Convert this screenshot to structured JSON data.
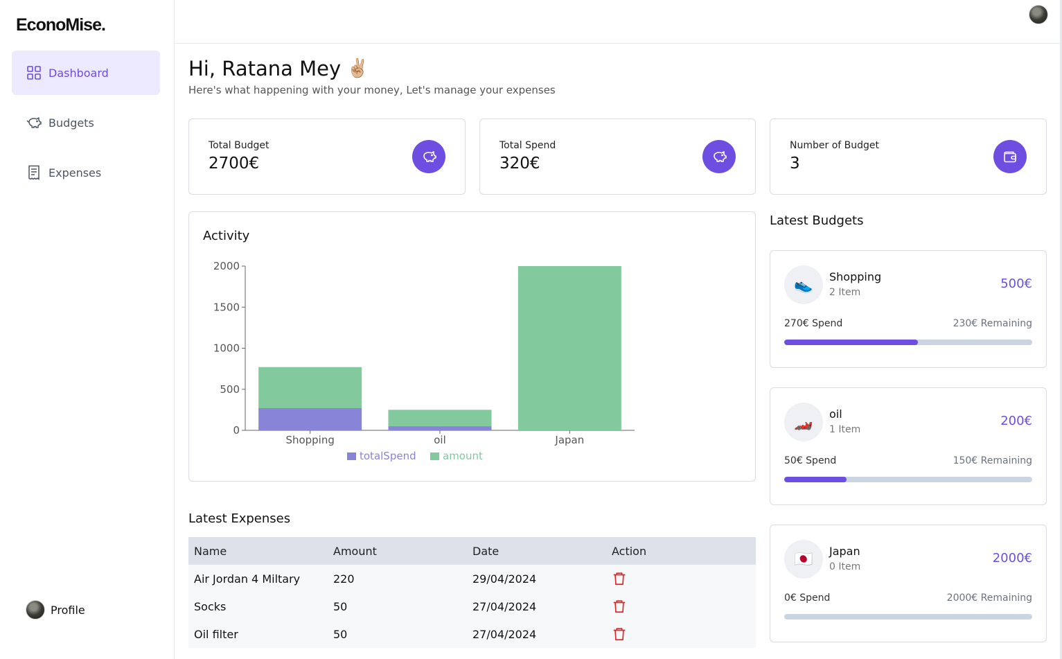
{
  "app": {
    "logo": "EconoMise."
  },
  "sidebar": {
    "items": [
      {
        "label": "Dashboard",
        "icon": "dashboard-grid-icon"
      },
      {
        "label": "Budgets",
        "icon": "piggy-bank-icon"
      },
      {
        "label": "Expenses",
        "icon": "receipt-icon"
      }
    ],
    "profile_label": "Profile"
  },
  "header": {
    "greeting": "Hi, Ratana Mey",
    "greeting_emoji": "✌🏼",
    "subtitle": "Here's what happening with your money, Let's manage your expenses"
  },
  "stats": [
    {
      "label": "Total Budget",
      "value": "2700€",
      "icon": "piggy-bank-icon"
    },
    {
      "label": "Total Spend",
      "value": "320€",
      "icon": "piggy-bank-icon"
    },
    {
      "label": "Number of Budget",
      "value": "3",
      "icon": "wallet-icon"
    }
  ],
  "activity": {
    "title": "Activity"
  },
  "chart_data": {
    "type": "bar",
    "stacked": true,
    "categories": [
      "Shopping",
      "oil",
      "Japan"
    ],
    "series": [
      {
        "name": "totalSpend",
        "values": [
          270,
          50,
          0
        ],
        "color": "#8884d8"
      },
      {
        "name": "amount",
        "values": [
          500,
          200,
          2000
        ],
        "color": "#82ca9d"
      }
    ],
    "yticks": [
      0,
      500,
      1000,
      1500,
      2000
    ],
    "ylim": [
      0,
      2000
    ],
    "legend": "bottom",
    "grid": false
  },
  "expenses": {
    "title": "Latest Expenses",
    "columns": [
      "Name",
      "Amount",
      "Date",
      "Action"
    ],
    "rows": [
      {
        "name": "Air Jordan 4 Miltary",
        "amount": "220",
        "date": "29/04/2024"
      },
      {
        "name": "Socks",
        "amount": "50",
        "date": "27/04/2024"
      },
      {
        "name": "Oil filter",
        "amount": "50",
        "date": "27/04/2024"
      }
    ]
  },
  "budgets": {
    "title": "Latest Budgets",
    "items": [
      {
        "emoji": "👟",
        "name": "Shopping",
        "items": "2 Item",
        "amount": "500€",
        "spend": "270€ Spend",
        "remaining": "230€ Remaining",
        "progress": 0.54
      },
      {
        "emoji": "🏎️",
        "name": "oil",
        "items": "1 Item",
        "amount": "200€",
        "spend": "50€ Spend",
        "remaining": "150€ Remaining",
        "progress": 0.25
      },
      {
        "emoji": "🇯🇵",
        "name": "Japan",
        "items": "0 Item",
        "amount": "2000€",
        "spend": "0€ Spend",
        "remaining": "2000€ Remaining",
        "progress": 0
      }
    ]
  },
  "colors": {
    "accent": "#6d4ee0",
    "accent_light": "#ede9fe",
    "spend_bar": "#8884d8",
    "amount_bar": "#82ca9d",
    "delete": "#dc2626"
  }
}
